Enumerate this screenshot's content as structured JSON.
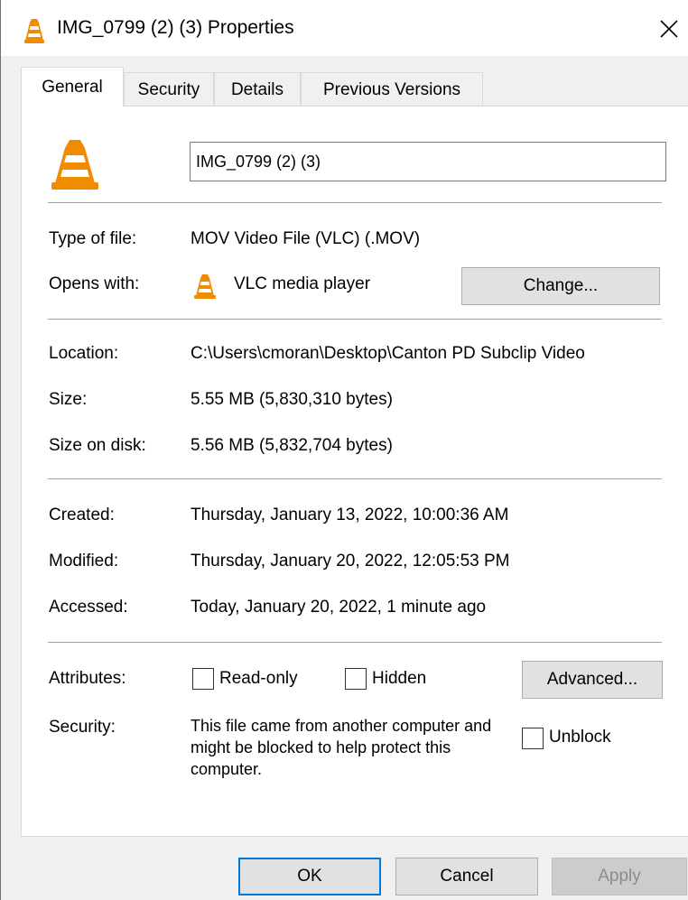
{
  "window": {
    "title": "IMG_0799 (2) (3) Properties"
  },
  "tabs": [
    {
      "label": "General",
      "active": true
    },
    {
      "label": "Security",
      "active": false
    },
    {
      "label": "Details",
      "active": false
    },
    {
      "label": "Previous Versions",
      "active": false
    }
  ],
  "general": {
    "file_name": "IMG_0799 (2) (3)",
    "type_label": "Type of file:",
    "type_value": "MOV Video File (VLC) (.MOV)",
    "opens_label": "Opens with:",
    "opens_value": "VLC media player",
    "change_button": "Change...",
    "location_label": "Location:",
    "location_value": "C:\\Users\\cmoran\\Desktop\\Canton PD Subclip Video",
    "size_label": "Size:",
    "size_value": "5.55 MB (5,830,310 bytes)",
    "size_disk_label": "Size on disk:",
    "size_disk_value": "5.56 MB (5,832,704 bytes)",
    "created_label": "Created:",
    "created_value": "Thursday, January 13, 2022, 10:00:36 AM",
    "modified_label": "Modified:",
    "modified_value": "Thursday, January 20, 2022, 12:05:53 PM",
    "accessed_label": "Accessed:",
    "accessed_value": "Today, January 20, 2022, 1 minute ago",
    "attributes_label": "Attributes:",
    "readonly_label": "Read-only",
    "readonly_checked": false,
    "hidden_label": "Hidden",
    "hidden_checked": false,
    "advanced_button": "Advanced...",
    "security_label": "Security:",
    "security_text": "This file came from another computer and might be blocked to help protect this computer.",
    "unblock_label": "Unblock",
    "unblock_checked": false
  },
  "footer": {
    "ok": "OK",
    "cancel": "Cancel",
    "apply": "Apply"
  },
  "icons": {
    "app": "vlc-cone-icon",
    "close": "close-icon"
  },
  "colors": {
    "vlc_orange": "#f08c00",
    "accent": "#0078d7"
  }
}
